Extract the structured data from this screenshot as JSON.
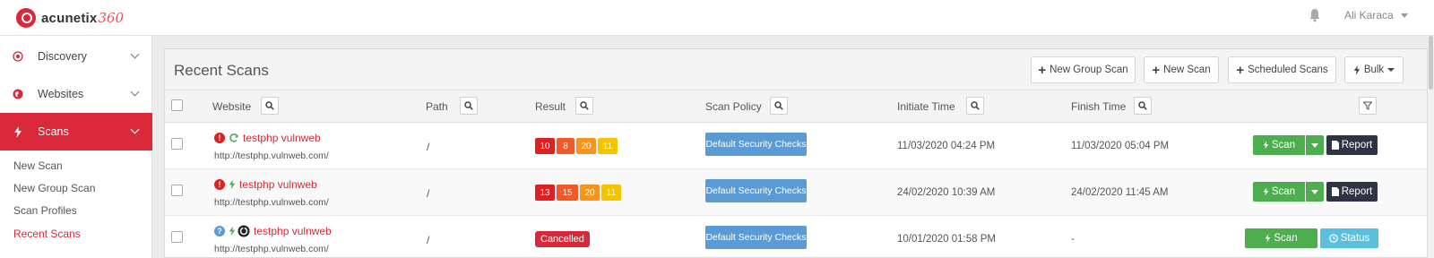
{
  "app": {
    "logo_text": "acunetix",
    "logo_suffix": "360"
  },
  "header": {
    "user_name": "Ali Karaca"
  },
  "sidebar": {
    "items": [
      {
        "label": "Discovery",
        "icon": "target-icon"
      },
      {
        "label": "Websites",
        "icon": "globe-icon"
      },
      {
        "label": "Scans",
        "icon": "bolt-icon",
        "active": true
      }
    ],
    "sub_items": [
      {
        "label": "New Scan"
      },
      {
        "label": "New Group Scan"
      },
      {
        "label": "Scan Profiles"
      },
      {
        "label": "Recent Scans",
        "active": true
      }
    ]
  },
  "main": {
    "title": "Recent Scans",
    "buttons": {
      "new_group_scan": "New Group Scan",
      "new_scan": "New Scan",
      "scheduled_scans": "Scheduled Scans",
      "bulk": "Bulk"
    },
    "columns": {
      "website": "Website",
      "path": "Path",
      "result": "Result",
      "scan_policy": "Scan Policy",
      "initiate_time": "Initiate Time",
      "finish_time": "Finish Time"
    },
    "rows": [
      {
        "name": "testphp vulnweb",
        "url": "http://testphp.vulnweb.com/",
        "path": "/",
        "severity": [
          "10",
          "8",
          "20",
          "11"
        ],
        "policy": "Default Security Checks",
        "initiate": "11/03/2020 04:24 PM",
        "finish": "11/03/2020 05:04 PM",
        "scan_label": "Scan",
        "report_label": "Report"
      },
      {
        "name": "testphp vulnweb",
        "url": "http://testphp.vulnweb.com/",
        "path": "/",
        "severity": [
          "13",
          "15",
          "20",
          "11"
        ],
        "policy": "Default Security Checks",
        "initiate": "24/02/2020 10:39 AM",
        "finish": "24/02/2020 11:45 AM",
        "scan_label": "Scan",
        "report_label": "Report"
      },
      {
        "name": "testphp vulnweb",
        "url": "http://testphp.vulnweb.com/",
        "path": "/",
        "status": "Cancelled",
        "policy": "Default Security Checks",
        "initiate": "10/01/2020 01:58 PM",
        "finish": "-",
        "scan_label": "Scan",
        "status_label": "Status"
      }
    ]
  },
  "colors": {
    "brand": "#d8283a",
    "critical": "#e02020",
    "high": "#f05a28",
    "medium": "#f7941d",
    "low": "#f5c400",
    "policy": "#5b9bd5",
    "scan_button": "#4cae4c",
    "report_button": "#2e3442",
    "status_button": "#5bc0de"
  }
}
